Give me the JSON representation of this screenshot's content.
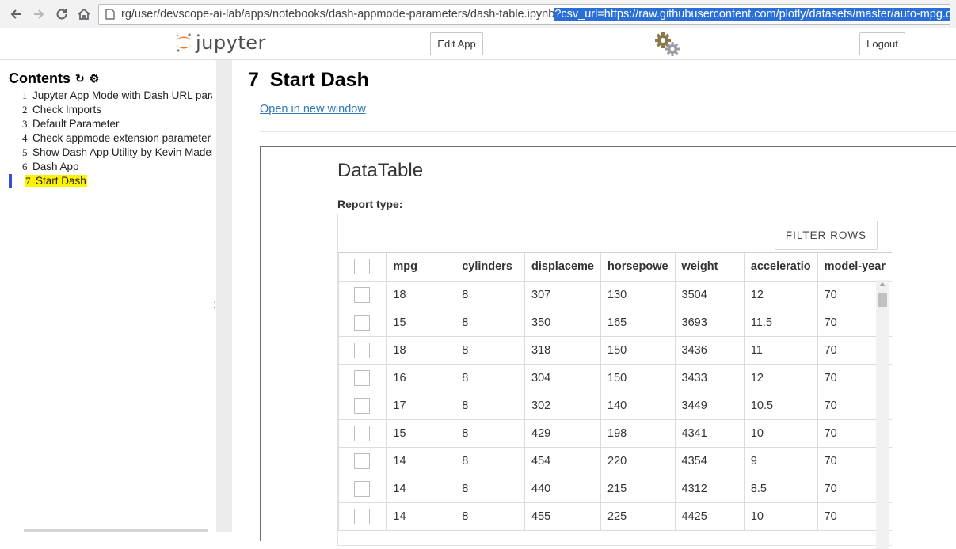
{
  "browser": {
    "url_plain": "rg/user/devscope-ai-lab/apps/notebooks/dash-appmode-parameters/dash-table.ipynb",
    "url_selected": "?csv_url=https://raw.githubusercontent.com/plotly/datasets/master/auto-mpg.csv"
  },
  "header": {
    "logo_text": "jupyter",
    "edit_app": "Edit App",
    "logout": "Logout"
  },
  "toc": {
    "title": "Contents",
    "items": [
      {
        "num": "1",
        "label": "Jupyter App Mode with Dash URL para"
      },
      {
        "num": "2",
        "label": "Check Imports"
      },
      {
        "num": "3",
        "label": "Default Parameter"
      },
      {
        "num": "4",
        "label": "Check appmode extension parameter"
      },
      {
        "num": "5",
        "label": "Show Dash App Utility by Kevin Mader"
      },
      {
        "num": "6",
        "label": "Dash App"
      },
      {
        "num": "7",
        "label": "Start Dash"
      }
    ]
  },
  "main": {
    "heading_num": "7",
    "heading": "Start Dash",
    "open_link": "Open in new window"
  },
  "app": {
    "title": "DataTable",
    "report_label": "Report type:",
    "filter_rows": "FILTER ROWS",
    "columns": [
      "mpg",
      "cylinders",
      "displaceme",
      "horsepowe",
      "weight",
      "acceleratio",
      "model-year"
    ],
    "rows": [
      [
        "18",
        "8",
        "307",
        "130",
        "3504",
        "12",
        "70"
      ],
      [
        "15",
        "8",
        "350",
        "165",
        "3693",
        "11.5",
        "70"
      ],
      [
        "18",
        "8",
        "318",
        "150",
        "3436",
        "11",
        "70"
      ],
      [
        "16",
        "8",
        "304",
        "150",
        "3433",
        "12",
        "70"
      ],
      [
        "17",
        "8",
        "302",
        "140",
        "3449",
        "10.5",
        "70"
      ],
      [
        "15",
        "8",
        "429",
        "198",
        "4341",
        "10",
        "70"
      ],
      [
        "14",
        "8",
        "454",
        "220",
        "4354",
        "9",
        "70"
      ],
      [
        "14",
        "8",
        "440",
        "215",
        "4312",
        "8.5",
        "70"
      ],
      [
        "14",
        "8",
        "455",
        "225",
        "4425",
        "10",
        "70"
      ]
    ]
  },
  "colors": {
    "accent_link": "#337ab7",
    "url_selection": "#2a6fd6",
    "toc_highlight": "#fff200",
    "toc_marker": "#3b4bd6",
    "jupyter_orange": "#f37726"
  }
}
